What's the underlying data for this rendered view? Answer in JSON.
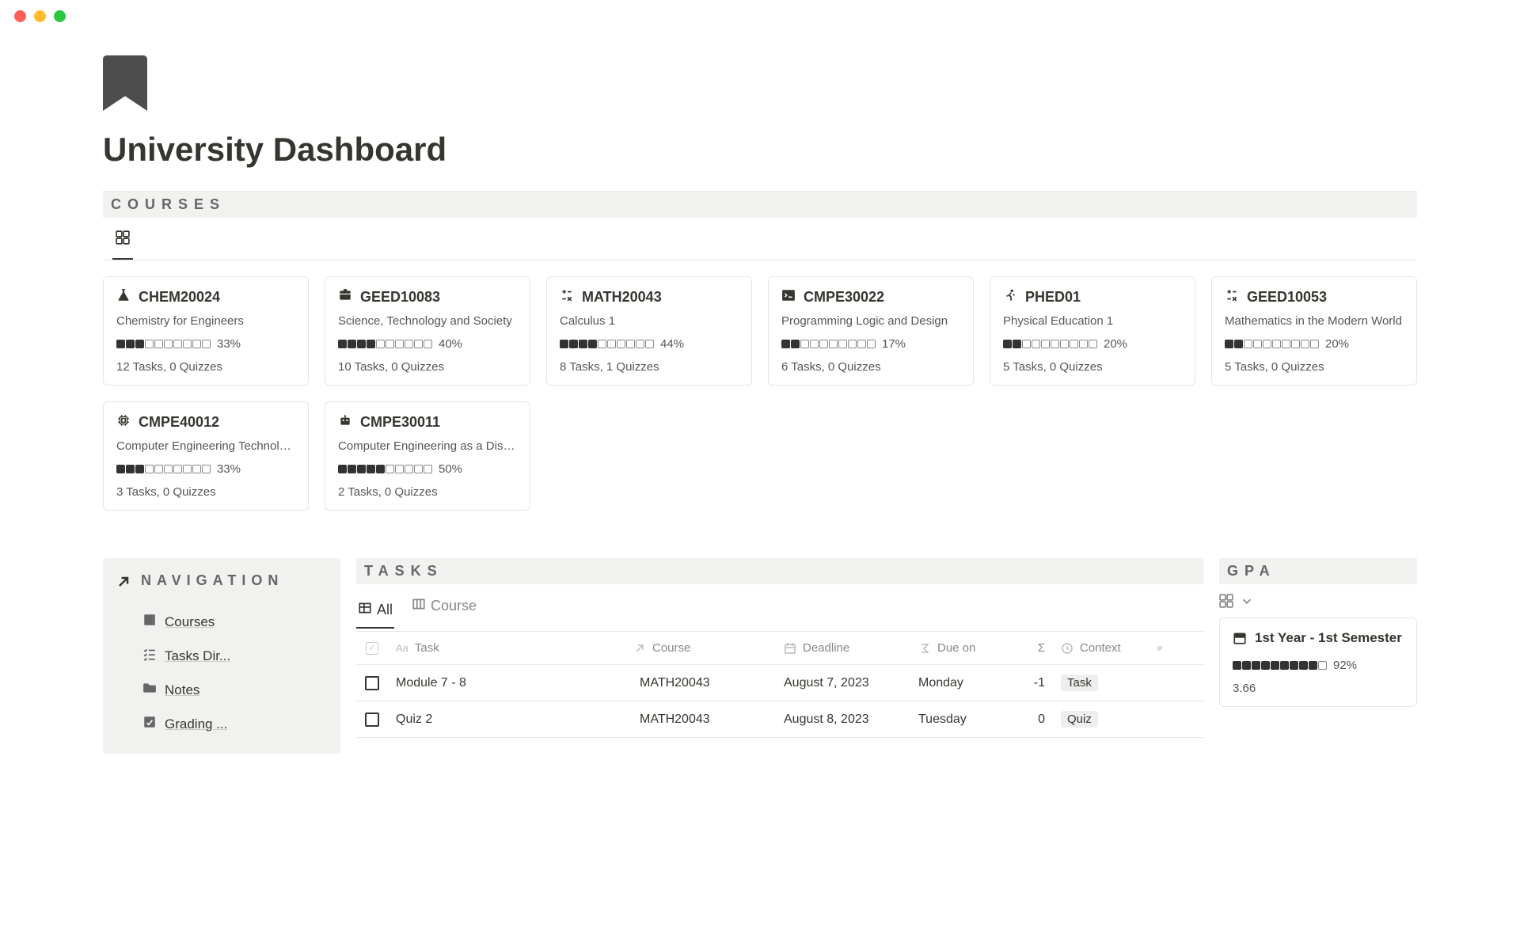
{
  "page": {
    "title": "University Dashboard"
  },
  "sections": {
    "courses": "COURSES",
    "navigation": "NAVIGATION",
    "tasks": "TASKS",
    "gpa": "GPA"
  },
  "courses": [
    {
      "icon": "flask",
      "code": "CHEM20024",
      "name": "Chemistry for Engineers",
      "progress_filled": 3,
      "progress_total": 10,
      "percent": "33%",
      "stats": "12 Tasks, 0 Quizzes"
    },
    {
      "icon": "briefcase",
      "code": "GEED10083",
      "name": "Science, Technology and Society",
      "progress_filled": 4,
      "progress_total": 10,
      "percent": "40%",
      "stats": "10 Tasks, 0 Quizzes"
    },
    {
      "icon": "calculator",
      "code": "MATH20043",
      "name": "Calculus 1",
      "progress_filled": 4,
      "progress_total": 10,
      "percent": "44%",
      "stats": "8 Tasks, 1 Quizzes"
    },
    {
      "icon": "terminal",
      "code": "CMPE30022",
      "name": "Programming Logic and Design",
      "progress_filled": 2,
      "progress_total": 10,
      "percent": "17%",
      "stats": "6 Tasks, 0 Quizzes"
    },
    {
      "icon": "runner",
      "code": "PHED01",
      "name": "Physical Education 1",
      "progress_filled": 2,
      "progress_total": 10,
      "percent": "20%",
      "stats": "5 Tasks, 0 Quizzes"
    },
    {
      "icon": "calculator",
      "code": "GEED10053",
      "name": "Mathematics in the Modern World",
      "progress_filled": 2,
      "progress_total": 10,
      "percent": "20%",
      "stats": "5 Tasks, 0 Quizzes"
    },
    {
      "icon": "chip",
      "code": "CMPE40012",
      "name": "Computer Engineering Technology",
      "progress_filled": 3,
      "progress_total": 10,
      "percent": "33%",
      "stats": "3 Tasks, 0 Quizzes"
    },
    {
      "icon": "robot",
      "code": "CMPE30011",
      "name": "Computer Engineering as a Discipline",
      "progress_filled": 5,
      "progress_total": 10,
      "percent": "50%",
      "stats": "2 Tasks, 0 Quizzes"
    }
  ],
  "nav": {
    "items": [
      {
        "icon": "book",
        "label": "Courses"
      },
      {
        "icon": "checklist",
        "label": "Tasks Dir..."
      },
      {
        "icon": "folder",
        "label": "Notes"
      },
      {
        "icon": "grade",
        "label": "Grading ..."
      }
    ]
  },
  "tasks": {
    "tabs": [
      {
        "icon": "table",
        "label": "All",
        "active": true
      },
      {
        "icon": "board",
        "label": "Course",
        "active": false
      }
    ],
    "columns": {
      "task": "Task",
      "course": "Course",
      "deadline": "Deadline",
      "dueon": "Due on",
      "sigma": "Σ",
      "context": "Context"
    },
    "rows": [
      {
        "name": "Module 7 - 8",
        "course": "MATH20043",
        "deadline": "August 7, 2023",
        "dueon": "Monday",
        "sigma": "-1",
        "context": "Task"
      },
      {
        "name": "Quiz 2",
        "course": "MATH20043",
        "deadline": "August 8, 2023",
        "dueon": "Tuesday",
        "sigma": "0",
        "context": "Quiz"
      }
    ]
  },
  "gpa": {
    "card": {
      "title": "1st Year - 1st Semester",
      "progress_filled": 9,
      "progress_total": 10,
      "percent": "92%",
      "value": "3.66"
    }
  }
}
